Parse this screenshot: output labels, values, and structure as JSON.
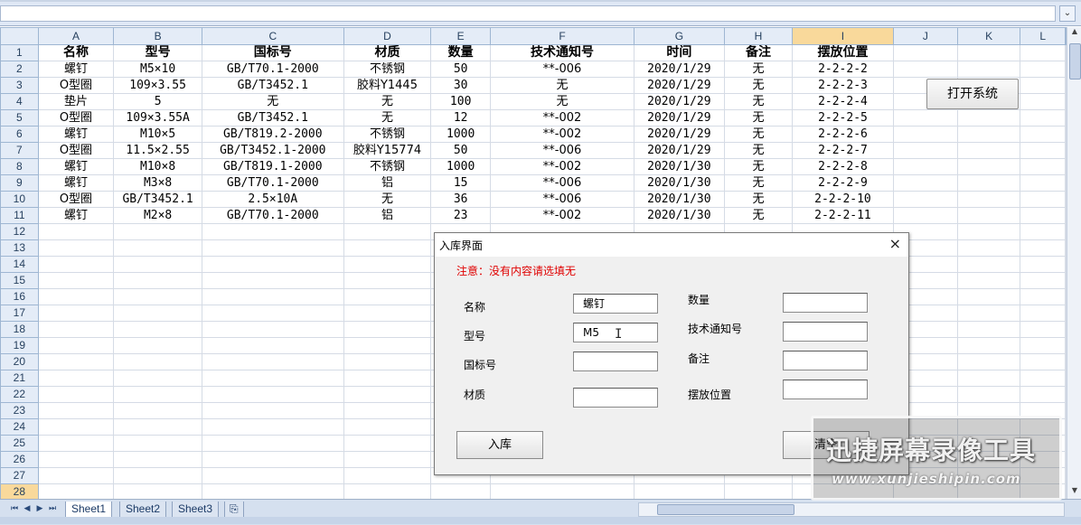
{
  "columns": [
    "A",
    "B",
    "C",
    "D",
    "E",
    "F",
    "G",
    "H",
    "I",
    "J",
    "K",
    "L"
  ],
  "row_numbers": [
    1,
    2,
    3,
    4,
    5,
    6,
    7,
    8,
    9,
    10,
    11,
    12,
    13,
    14,
    15,
    16,
    17,
    18,
    19,
    20,
    21,
    22,
    23,
    24,
    25,
    26,
    27,
    28
  ],
  "selected_column": "I",
  "selected_row": 28,
  "headers": [
    "名称",
    "型号",
    "国标号",
    "材质",
    "数量",
    "技术通知号",
    "时间",
    "备注",
    "摆放位置"
  ],
  "rows": [
    [
      "螺钉",
      "M5×10",
      "GB/T70.1-2000",
      "不锈钢",
      "50",
      "**-006",
      "2020/1/29",
      "无",
      "2-2-2-2"
    ],
    [
      "O型圈",
      "109×3.55",
      "GB/T3452.1",
      "胶料Y1445",
      "30",
      "无",
      "2020/1/29",
      "无",
      "2-2-2-3"
    ],
    [
      "垫片",
      "5",
      "无",
      "无",
      "100",
      "无",
      "2020/1/29",
      "无",
      "2-2-2-4"
    ],
    [
      "O型圈",
      "109×3.55A",
      "GB/T3452.1",
      "无",
      "12",
      "**-002",
      "2020/1/29",
      "无",
      "2-2-2-5"
    ],
    [
      "螺钉",
      "M10×5",
      "GB/T819.2-2000",
      "不锈钢",
      "1000",
      "**-002",
      "2020/1/29",
      "无",
      "2-2-2-6"
    ],
    [
      "O型圈",
      "11.5×2.55",
      "GB/T3452.1-2000",
      "胶料Y15774",
      "50",
      "**-006",
      "2020/1/29",
      "无",
      "2-2-2-7"
    ],
    [
      "螺钉",
      "M10×8",
      "GB/T819.1-2000",
      "不锈钢",
      "1000",
      "**-002",
      "2020/1/30",
      "无",
      "2-2-2-8"
    ],
    [
      "螺钉",
      "M3×8",
      "GB/T70.1-2000",
      "铝",
      "15",
      "**-006",
      "2020/1/30",
      "无",
      "2-2-2-9"
    ],
    [
      "O型圈",
      "GB/T3452.1",
      "2.5×10A",
      "无",
      "36",
      "**-006",
      "2020/1/30",
      "无",
      "2-2-2-10"
    ],
    [
      "螺钉",
      "M2×8",
      "GB/T70.1-2000",
      "铝",
      "23",
      "**-002",
      "2020/1/30",
      "无",
      "2-2-2-11"
    ]
  ],
  "open_system_button": "打开系统",
  "sheet_tabs": [
    "Sheet1",
    "Sheet2",
    "Sheet3"
  ],
  "active_sheet": "Sheet1",
  "dialog": {
    "title": "入库界面",
    "close": "×",
    "note": "注意：没有内容请选填无",
    "labels": {
      "name": "名称",
      "model": "型号",
      "standard": "国标号",
      "material": "材质",
      "quantity": "数量",
      "tech_notice": "技术通知号",
      "remark": "备注",
      "location": "摆放位置"
    },
    "values": {
      "name": "螺钉",
      "model": "M5",
      "standard": "",
      "material": "",
      "quantity": "",
      "tech_notice": "",
      "remark": "",
      "location": ""
    },
    "stock_in_button": "入库",
    "clear_button": "清空"
  },
  "watermark": {
    "line1": "迅捷屏幕录像工具",
    "line2": "www.xunjieshipin.com"
  }
}
